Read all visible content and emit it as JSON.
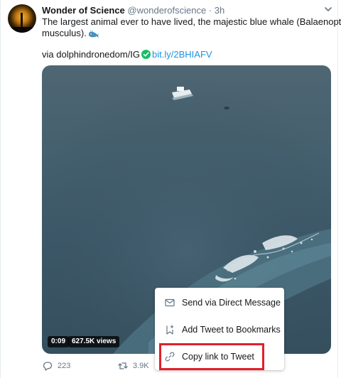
{
  "tweet": {
    "author_name": "Wonder of Science",
    "author_handle": "@wonderofscience",
    "separator": "·",
    "time": "3h",
    "text_line1": "The largest animal ever to have lived, the majestic blue whale (Balaenoptera",
    "text_line2": "musculus).",
    "via_text": "via dolphindronedom/IG",
    "link_text": "bit.ly/2BHIAFV"
  },
  "media": {
    "duration": "0:09",
    "views": "627.5K views"
  },
  "actions": {
    "reply_count": "223",
    "retweet_count": "3.9K"
  },
  "share_menu": {
    "items": [
      {
        "label": "Send via Direct Message",
        "icon": "mail-icon"
      },
      {
        "label": "Add Tweet to Bookmarks",
        "icon": "bookmark-add-icon"
      },
      {
        "label": "Copy link to Tweet",
        "icon": "link-icon"
      }
    ]
  },
  "colors": {
    "link": "#1b95e0",
    "verified_check": "#17bf63",
    "highlight_box": "#e0202a",
    "secondary_text": "#657786"
  }
}
